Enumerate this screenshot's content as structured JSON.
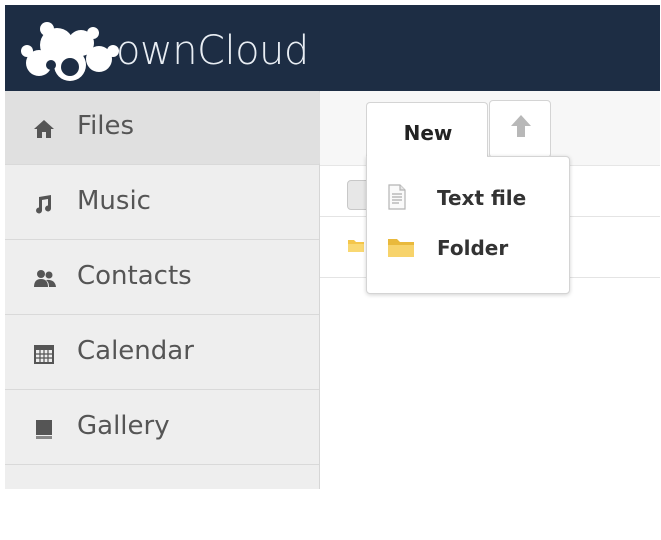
{
  "header": {
    "logo_text": "ownCloud"
  },
  "sidebar": {
    "items": [
      {
        "label": "Files",
        "icon": "home-icon",
        "active": true
      },
      {
        "label": "Music",
        "icon": "music-note-icon"
      },
      {
        "label": "Contacts",
        "icon": "people-icon"
      },
      {
        "label": "Calendar",
        "icon": "calendar-icon"
      },
      {
        "label": "Gallery",
        "icon": "picture-icon"
      }
    ]
  },
  "toolbar": {
    "new_label": "New",
    "upload_icon": "upload-arrow-icon"
  },
  "new_menu": {
    "items": [
      {
        "label": "Text file",
        "icon": "text-file-icon"
      },
      {
        "label": "Folder",
        "icon": "folder-icon"
      }
    ]
  },
  "colors": {
    "header_bg": "#1d2d44",
    "sidebar_bg": "#eeeeee",
    "folder": "#f4c64a"
  }
}
